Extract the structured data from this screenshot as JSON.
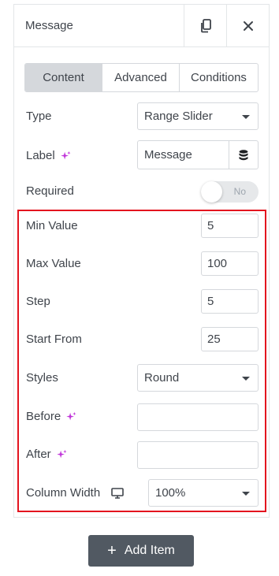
{
  "header": {
    "title": "Message"
  },
  "tabs": [
    {
      "label": "Content",
      "active": true
    },
    {
      "label": "Advanced",
      "active": false
    },
    {
      "label": "Conditions",
      "active": false
    }
  ],
  "fields": {
    "type": {
      "label": "Type",
      "value": "Range Slider"
    },
    "label": {
      "label": "Label",
      "value": "Message",
      "icon": "ai-sparkle-icon"
    },
    "required": {
      "label": "Required",
      "toggle_text": "No",
      "on": false
    },
    "min_value": {
      "label": "Min Value",
      "value": "5"
    },
    "max_value": {
      "label": "Max Value",
      "value": "100"
    },
    "step": {
      "label": "Step",
      "value": "5"
    },
    "start_from": {
      "label": "Start From",
      "value": "25"
    },
    "styles": {
      "label": "Styles",
      "value": "Round"
    },
    "before": {
      "label": "Before",
      "value": ""
    },
    "after": {
      "label": "After",
      "value": ""
    },
    "column_width": {
      "label": "Column Width",
      "value": "100%",
      "icon": "desktop-icon"
    }
  },
  "footer": {
    "add_item_label": "Add Item"
  },
  "colors": {
    "accent": "#c036d9",
    "highlight": "#e3141f",
    "button": "#515962"
  }
}
